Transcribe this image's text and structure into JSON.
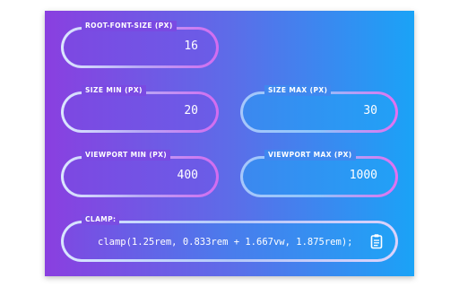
{
  "fields": {
    "root_font_size": {
      "label": "ROOT-FONT-SIZE (PX)",
      "value": "16"
    },
    "size_min": {
      "label": "SIZE MIN (PX)",
      "value": "20"
    },
    "size_max": {
      "label": "SIZE MAX (PX)",
      "value": "30"
    },
    "viewport_min": {
      "label": "VIEWPORT MIN (PX)",
      "value": "400"
    },
    "viewport_max": {
      "label": "VIEWPORT MAX (PX)",
      "value": "1000"
    }
  },
  "clamp": {
    "label": "CLAMP:",
    "output": "clamp(1.25rem, 0.833rem + 1.667vw, 1.875rem);",
    "copy_icon": "clipboard-icon"
  },
  "colors": {
    "gradient_start": "#8a3fe0",
    "gradient_end": "#1aa3f7",
    "text": "#ffffff"
  }
}
